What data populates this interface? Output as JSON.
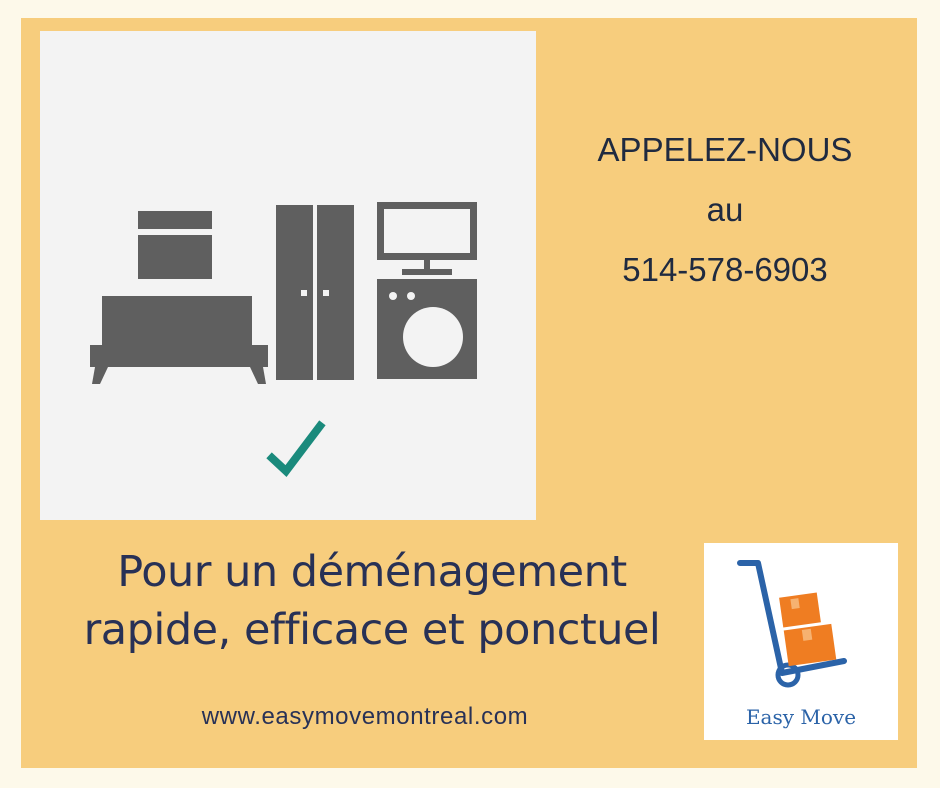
{
  "call": {
    "line1": "APPELEZ-NOUS",
    "line2": "au",
    "phone": "514-578-6903"
  },
  "tagline": {
    "line1": "Pour un déménagement",
    "line2": "rapide, efficace et ponctuel"
  },
  "website": "www.easymovemontreal.com",
  "logo": {
    "name": "Easy Move"
  },
  "illustration": {
    "icons": [
      "bed-icon",
      "box-icon",
      "wardrobe-icon",
      "tv-icon",
      "washing-machine-icon",
      "checkmark-icon"
    ]
  },
  "colors": {
    "background": "#f7cd7d",
    "icon_gray": "#5f5f5f",
    "checkmark": "#1a8a7c",
    "text_dark": "#283156",
    "logo_blue": "#2b63a8",
    "logo_orange": "#ef7d22"
  }
}
